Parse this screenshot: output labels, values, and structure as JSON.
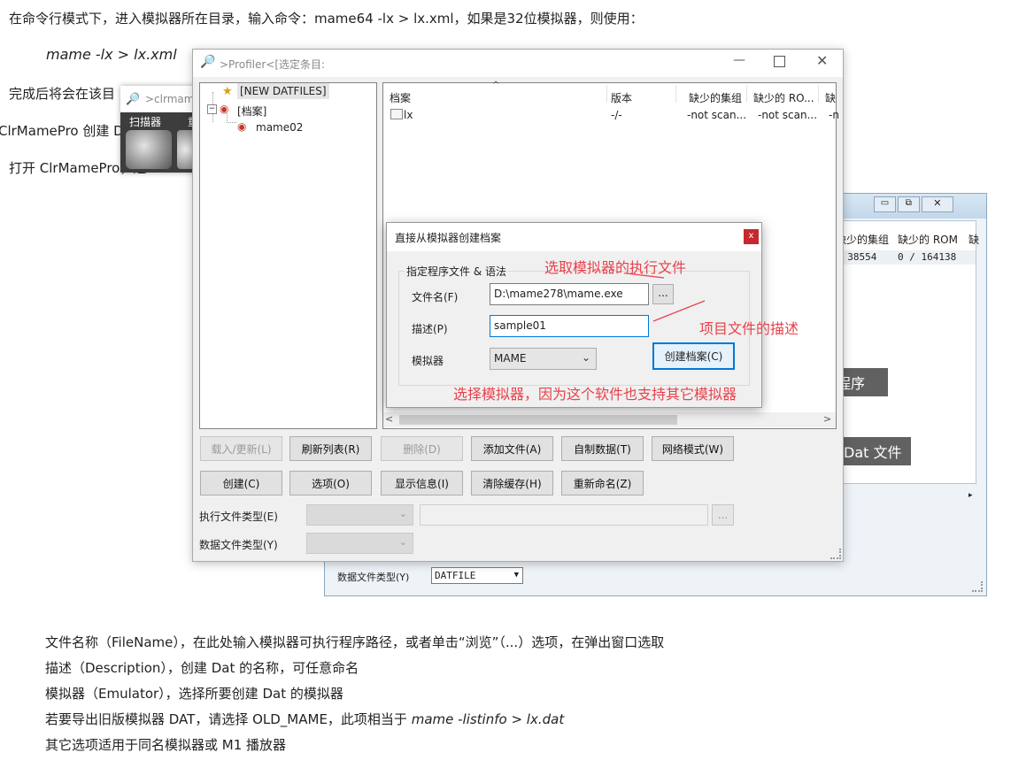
{
  "doc": {
    "line1": "在命令行模式下，进入模拟器所在目录，输入命令：mame64 -lx > lx.xml，如果是32位模拟器，则使用：",
    "cmd": "mame -lx > lx.xml",
    "line3": "完成后将会在该目",
    "line4": "ClrMamePro 创建 D",
    "line5": "打开 ClrMamePro，进",
    "b1": "文件名称（FileName），在此处输入模拟器可执行程序路径，或者单击“浏览”（...）选项，在弹出窗口选取",
    "b2": "描述（Description），创建 Dat 的名称，可任意命名",
    "b3": "模拟器（Emulator），选择所要创建 Dat 的模拟器",
    "b4_pre": "若要导出旧版模拟器 DAT，请选择 OLD_MAME，此项相当于 ",
    "b4_cmd": "mame -listinfo > lx.dat",
    "b5": "其它选项适用于同名模拟器或 M1 播放器"
  },
  "small_window": {
    "title": ">clrmam",
    "tab": "扫描器",
    "tab2": "重"
  },
  "bg_window": {
    "col1": "缺少的集组",
    "col2": "缺少的 ROM",
    "col3": "缺",
    "val1": "/ 38554",
    "val2": "0 / 164138",
    "btn_partial": "程序",
    "btn_dat": "Dat 文件",
    "datatype_label": "数据文件类型(Y)",
    "datatype_value": "DATFILE"
  },
  "profiler": {
    "title": ">Profiler<[选定条目:",
    "tree": [
      "[NEW DATFILES]",
      "[档案]",
      "mame02"
    ],
    "columns": [
      "档案",
      "版本",
      "缺少的集组",
      "缺少的 RO...",
      "缺"
    ],
    "row": {
      "name": "lx",
      "version": "-/-",
      "sets": "-not scan...",
      "roms": "-not scan...",
      "extra": "-n"
    },
    "buttons_row1": [
      "载入/更新(L)",
      "刷新列表(R)",
      "删除(D)",
      "添加文件(A)",
      "自制数据(T)",
      "网络模式(W)"
    ],
    "buttons_row2": [
      "创建(C)",
      "选项(O)",
      "显示信息(I)",
      "清除缓存(H)",
      "重新命名(Z)"
    ],
    "exec_type_label": "执行文件类型(E)",
    "data_type_label": "数据文件类型(Y)",
    "browse": "..."
  },
  "dialog": {
    "title": "直接从模拟器创建档案",
    "group": "指定程序文件 & 语法",
    "filename_label": "文件名(F)",
    "filename_value": "D:\\mame278\\mame.exe",
    "browse": "...",
    "desc_label": "描述(P)",
    "desc_value": "sample01",
    "emu_label": "模拟器",
    "emu_value": "MAME",
    "create_btn": "创建档案(C)",
    "close": "x"
  },
  "annotations": {
    "a1": "选取模拟器的执行文件",
    "a2": "项目文件的描述",
    "a3": "选择模拟器，因为这个软件也支持其它模拟器"
  }
}
